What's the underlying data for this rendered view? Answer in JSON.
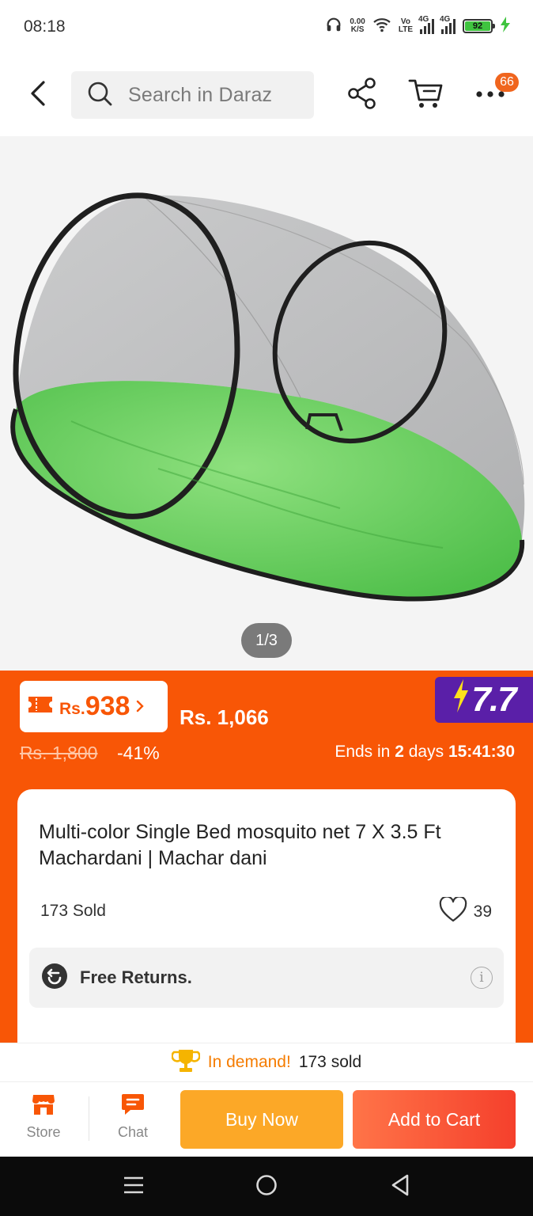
{
  "status_bar": {
    "time": "08:18",
    "net_speed": "0.00",
    "net_unit": "K/S",
    "volte_top": "Vo",
    "volte_bottom": "LTE",
    "sim1": "4G",
    "sim2": "4G",
    "battery": "92",
    "icons": [
      "headphones-icon",
      "wifi-icon",
      "signal-icon",
      "battery-icon",
      "charging-icon"
    ]
  },
  "header": {
    "search_placeholder": "Search in Daraz",
    "cart_badge": "66",
    "icons": [
      "back-icon",
      "search-icon",
      "share-icon",
      "cart-icon",
      "more-icon"
    ]
  },
  "gallery": {
    "counter": "1/3"
  },
  "price": {
    "voucher_currency": "Rs.",
    "voucher_amount": "938",
    "current": "Rs. 1,066",
    "campaign": "7.7",
    "original": "Rs. 1,800",
    "discount": "-41%",
    "ends_prefix": "Ends in",
    "ends_days": "2",
    "ends_days_unit": "days",
    "ends_time": "15:41:30"
  },
  "product": {
    "title": "Multi-color Single Bed mosquito net 7 X 3.5 Ft Machardani | Machar dani",
    "sold": "173 Sold",
    "wishlist_count": "39",
    "returns_label": "Free Returns."
  },
  "demand": {
    "label": "In demand!",
    "count": "173 sold"
  },
  "actions": {
    "store": "Store",
    "chat": "Chat",
    "buy_now": "Buy Now",
    "add_to_cart": "Add to Cart"
  },
  "colors": {
    "brand_orange": "#f85606",
    "buy_now": "#fca827",
    "add_to_cart": "#f5402c",
    "campaign_purple": "#5a1fa8"
  }
}
